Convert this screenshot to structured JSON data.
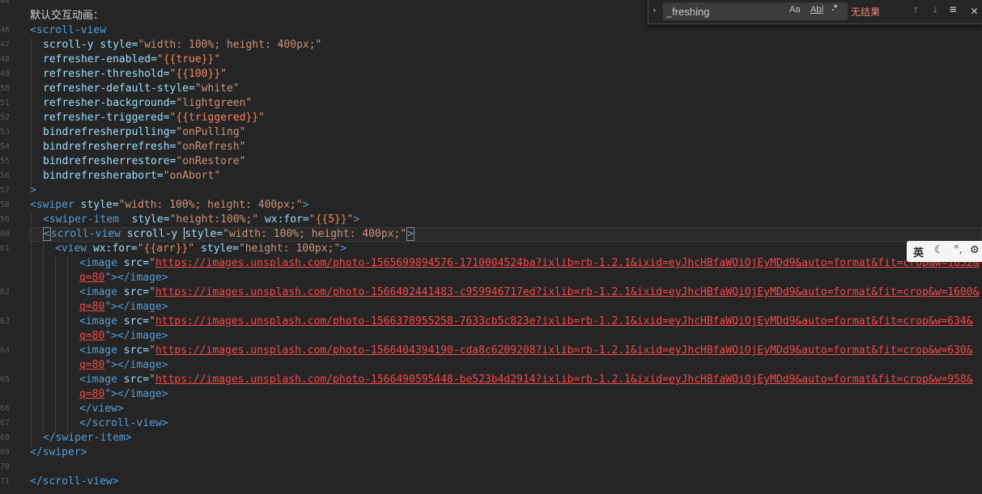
{
  "find_widget": {
    "query": "_freshing",
    "match_case_label": "Aa",
    "whole_word_label": "Ab|",
    "regex_label": ".*",
    "result": "无结果",
    "prev_icon": "arrow-up-icon",
    "next_icon": "arrow-down-icon",
    "selection_icon": "find-in-selection-icon",
    "close_icon": "close-icon"
  },
  "ime_bar": {
    "lang": "英",
    "moon": "☾",
    "punct": "°,",
    "gear": "⚙"
  },
  "gutter": {
    "lines": [
      "44",
      "45",
      "46",
      "47",
      "48",
      "49",
      "50",
      "51",
      "52",
      "53",
      "54",
      "55",
      "56",
      "57",
      "58",
      "59",
      "60",
      "61",
      "",
      "62",
      "",
      "63",
      "",
      "64",
      "",
      "65",
      "",
      "66",
      "67",
      "68",
      "69",
      "70",
      "71"
    ]
  },
  "code": {
    "l0": "默认交互动画：",
    "l1_tag": "<scroll-view",
    "l2_attr": "scroll-y style=",
    "l2_str": "\"width: 100%; height: 400px;\"",
    "l3_attr": "refresher-enabled=",
    "l3_q1": "\"",
    "l3_mus": "{{true}}",
    "l3_q2": "\"",
    "l4_attr": "refresher-threshold=",
    "l4_q1": "\"",
    "l4_mus": "{{100}}",
    "l4_q2": "\"",
    "l5_attr": "refresher-default-style=",
    "l5_str": "\"white\"",
    "l6_attr": "refresher-background=",
    "l6_str": "\"lightgreen\"",
    "l7_attr": "refresher-triggered=",
    "l7_q1": "\"",
    "l7_mus": "{{triggered}}",
    "l7_q2": "\"",
    "l8_attr": "bindrefresherpulling=",
    "l8_str": "\"onPulling\"",
    "l9_attr": "bindrefresherrefresh=",
    "l9_str": "\"onRefresh\"",
    "l10_attr": "bindrefresherrestore=",
    "l10_str": "\"onRestore\"",
    "l11_attr": "bindrefresherabort=",
    "l11_str": "\"onAbort\"",
    "l13_tag": ">",
    "l14_tag": "<swiper",
    "l14_attr": " style=",
    "l14_str": "\"width: 100%; height: 400px;\"",
    "l14_end": ">",
    "l15_tag": "<swiper-item",
    "l15_attr": "  style=",
    "l15_str": "\"height:100%;\"",
    "l15_attr2": " wx:for=",
    "l15_q1": "\"",
    "l15_mus": "{{5}}",
    "l15_q2": "\"",
    "l15_end": ">",
    "l16_lt": "<",
    "l16_tag": "scroll-view",
    "l16_attr": " scroll-y ",
    "l16_attr2": "style=",
    "l16_str": "\"width: 100%; height: 400px;\"",
    "l16_end": ">",
    "l17_tag": "<view",
    "l17_attr": " wx:for=",
    "l17_q1": "\"",
    "l17_mus": "{{arr}}",
    "l17_q2": "\"",
    "l17_attr2": " style=",
    "l17_str": "\"height: 100px;\"",
    "l17_end": ">",
    "img_tag": "<image",
    "img_attr": " src=",
    "img_q": "\"",
    "img1_url": "https://images.unsplash.com/photo-1565699894576-1710004524ba?ixlib=rb-1.2.1&ixid=eyJhcHBfaWQiOjEyMDd9&auto=format&fit=crop&w=1832&",
    "img1_tail": "q=80",
    "img2_url": "https://images.unsplash.com/photo-1566402441483-c959946717ed?ixlib=rb-1.2.1&ixid=eyJhcHBfaWQiOjEyMDd9&auto=format&fit=crop&w=1600&",
    "img2_tail": "q=80",
    "img3_url": "https://images.unsplash.com/photo-1566378955258-7633cb5c823e?ixlib=rb-1.2.1&ixid=eyJhcHBfaWQiOjEyMDd9&auto=format&fit=crop&w=634&",
    "img3_tail": "q=80",
    "img4_url": "https://images.unsplash.com/photo-1566404394190-cda8c6209208?ixlib=rb-1.2.1&ixid=eyJhcHBfaWQiOjEyMDd9&auto=format&fit=crop&w=630&",
    "img4_tail": "q=80",
    "img5_url": "https://images.unsplash.com/photo-1566490595448-be523b4d2914?ixlib=rb-1.2.1&ixid=eyJhcHBfaWQiOjEyMDd9&auto=format&fit=crop&w=958&",
    "img5_tail": "q=80",
    "img_close": "\"></image>",
    "l28": "</view>",
    "l29": "</scroll-view>",
    "l30": "</swiper-item>",
    "l31": "</swiper>",
    "l33": "</scroll-view>"
  }
}
